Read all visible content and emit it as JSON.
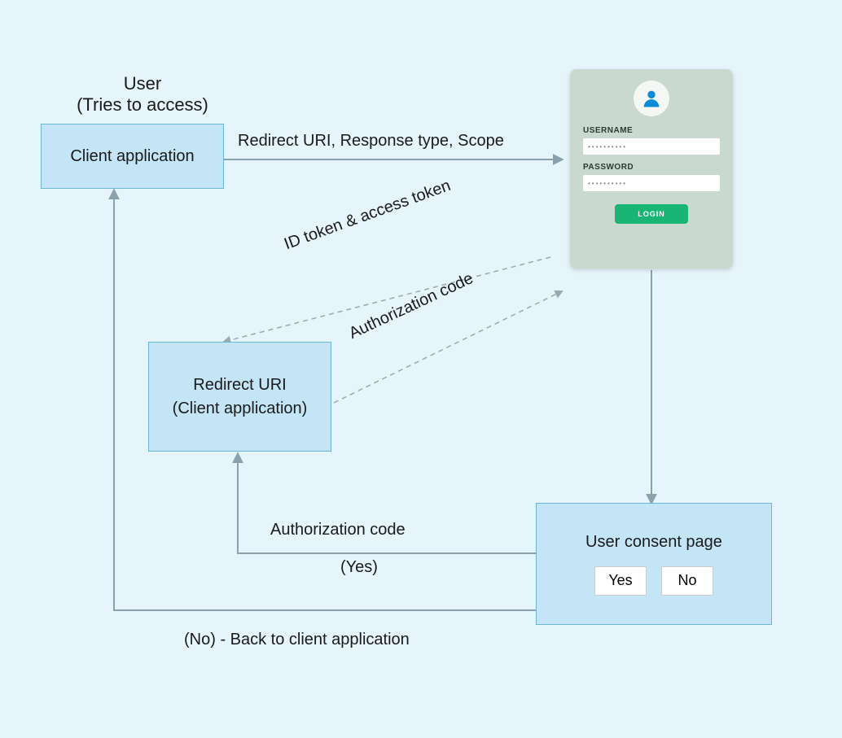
{
  "user_label": {
    "line1": "User",
    "line2": "(Tries to access)"
  },
  "client_app": {
    "label": "Client application"
  },
  "redirect_box": {
    "line1": "Redirect URI",
    "line2": "(Client application)"
  },
  "login_form": {
    "username_label": "USERNAME",
    "username_value": "••••••••••",
    "password_label": "PASSWORD",
    "password_value": "••••••••••",
    "login_btn": "LOGIN"
  },
  "consent": {
    "title": "User consent page",
    "yes": "Yes",
    "no": "No"
  },
  "flows": {
    "redirect_request": "Redirect URI, Response type, Scope",
    "id_token": "ID token & access token",
    "auth_code_up": "Authorization code",
    "auth_code_yes": "Authorization code",
    "yes_sub": "(Yes)",
    "no_back": "(No) - Back to client application"
  }
}
